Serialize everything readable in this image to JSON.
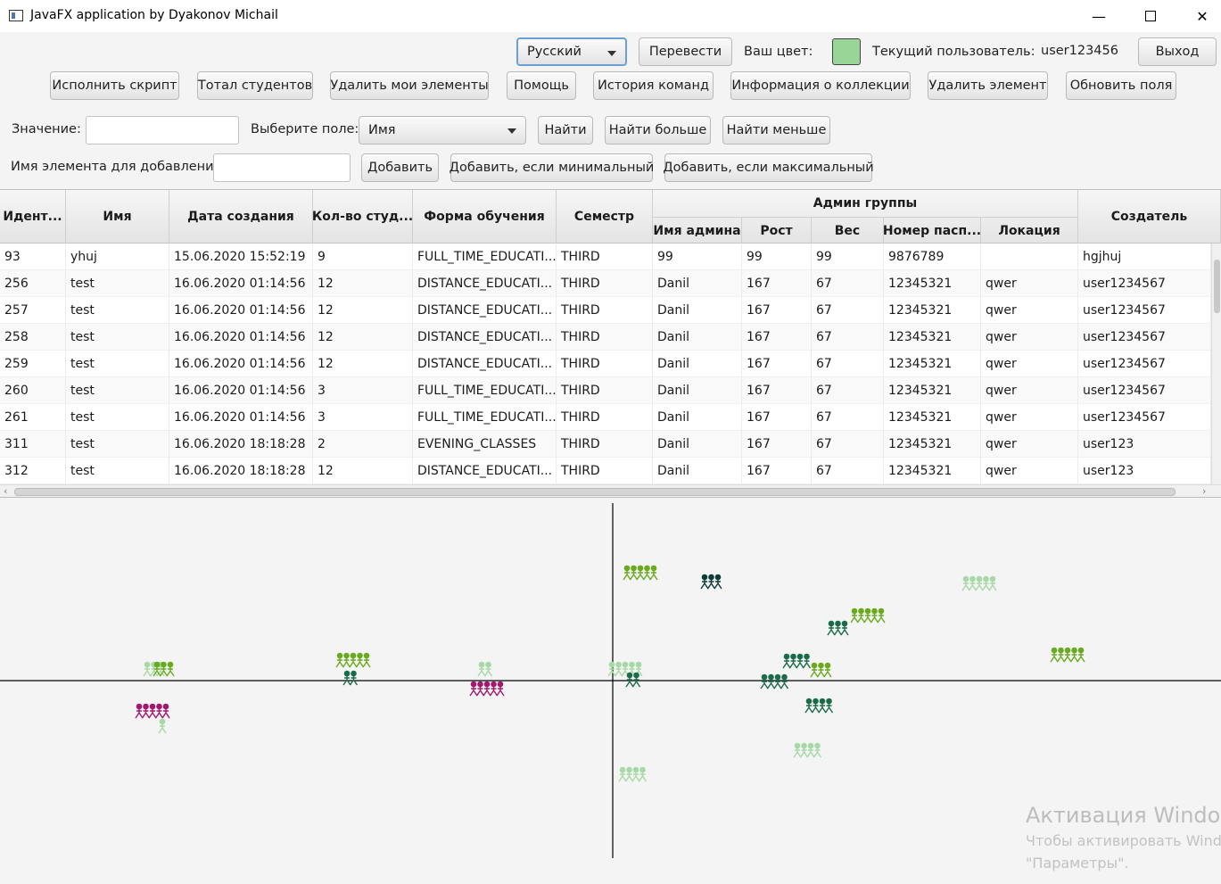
{
  "window": {
    "title": "JavaFX application by Dyakonov Michail",
    "minimize": "—",
    "close": "✕"
  },
  "toolbar": {
    "language": "Русский",
    "translate": "Перевести",
    "your_color_label": "Ваш цвет:",
    "your_color": "#99d596",
    "current_user_label": "Текущий пользователь:",
    "current_user": "user123456",
    "logout": "Выход"
  },
  "actions": {
    "execute_script": "Исполнить скрипт",
    "total_students": "Тотал студентов",
    "delete_my": "Удалить мои элементы",
    "help": "Помощь",
    "history": "История команд",
    "collection_info": "Информация о коллекции",
    "delete_element": "Удалить элемент",
    "refresh_fields": "Обновить поля"
  },
  "filter": {
    "value_label": "Значение:",
    "value": "",
    "field_label": "Выберите поле:",
    "field": "Имя",
    "find": "Найти",
    "find_greater": "Найти больше",
    "find_less": "Найти меньше"
  },
  "add": {
    "name_label": "Имя элемента для добавления:",
    "name_value": "",
    "add": "Добавить",
    "add_if_min": "Добавить, если минимальный",
    "add_if_max": "Добавить, если максимальный"
  },
  "table": {
    "columns": [
      "Идент...",
      "Имя",
      "Дата создания",
      "Кол-во студ...",
      "Форма обучения",
      "Семестр",
      "Имя админа",
      "Рост",
      "Вес",
      "Номер пасп...",
      "Локация",
      "Создатель"
    ],
    "group_header": "Админ группы",
    "rows": [
      [
        "93",
        "yhuj",
        "15.06.2020 15:52:19",
        "9",
        "FULL_TIME_EDUCATI...",
        "THIRD",
        "99",
        "99",
        "99",
        "9876789",
        "",
        "hgjhuj"
      ],
      [
        "256",
        "test",
        "16.06.2020 01:14:56",
        "12",
        "DISTANCE_EDUCATI...",
        "THIRD",
        "Danil",
        "167",
        "67",
        "12345321",
        "qwer",
        "user1234567"
      ],
      [
        "257",
        "test",
        "16.06.2020 01:14:56",
        "12",
        "DISTANCE_EDUCATI...",
        "THIRD",
        "Danil",
        "167",
        "67",
        "12345321",
        "qwer",
        "user1234567"
      ],
      [
        "258",
        "test",
        "16.06.2020 01:14:56",
        "12",
        "DISTANCE_EDUCATI...",
        "THIRD",
        "Danil",
        "167",
        "67",
        "12345321",
        "qwer",
        "user1234567"
      ],
      [
        "259",
        "test",
        "16.06.2020 01:14:56",
        "12",
        "DISTANCE_EDUCATI...",
        "THIRD",
        "Danil",
        "167",
        "67",
        "12345321",
        "qwer",
        "user1234567"
      ],
      [
        "260",
        "test",
        "16.06.2020 01:14:56",
        "3",
        "FULL_TIME_EDUCATI...",
        "THIRD",
        "Danil",
        "167",
        "67",
        "12345321",
        "qwer",
        "user1234567"
      ],
      [
        "261",
        "test",
        "16.06.2020 01:14:56",
        "3",
        "FULL_TIME_EDUCATI...",
        "THIRD",
        "Danil",
        "167",
        "67",
        "12345321",
        "qwer",
        "user1234567"
      ],
      [
        "311",
        "test",
        "16.06.2020 18:18:28",
        "2",
        "EVENING_CLASSES",
        "THIRD",
        "Danil",
        "167",
        "67",
        "12345321",
        "qwer",
        "user123"
      ],
      [
        "312",
        "test",
        "16.06.2020 18:18:28",
        "12",
        "DISTANCE_EDUCATI...",
        "THIRD",
        "Danil",
        "167",
        "67",
        "12345321",
        "qwer",
        "user123"
      ]
    ]
  },
  "watermark": {
    "line1": "Активация Window",
    "line2": "Чтобы активировать Wind",
    "line3": "\"Параметры\"."
  }
}
